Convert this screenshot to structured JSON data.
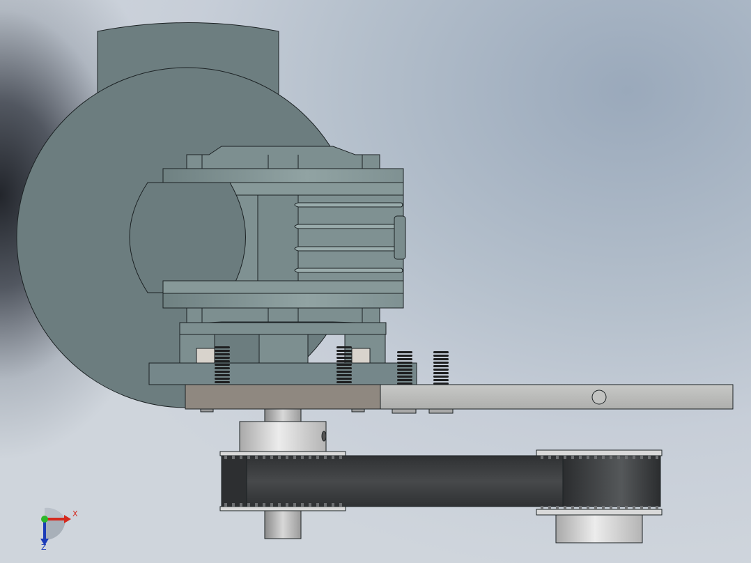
{
  "scene": {
    "type": "cad-assembly-view",
    "colors": {
      "motor_body": "#6e7f82",
      "gearbox": "#849697",
      "plate_dark": "#8f8880",
      "plate_light": "#b7b8b6",
      "belt": "#3d3f41",
      "pulley": "#cfcfcf",
      "screw": "#1e1f20",
      "edge": "#1c2224"
    },
    "components": [
      "motor-housing-icon",
      "gearbox-icon",
      "mounting-plate-icon",
      "timing-belt-icon",
      "drive-pulley-icon",
      "driven-pulley-icon",
      "set-screw-icon"
    ]
  },
  "triad": {
    "x_label": "X",
    "z_label": "Z",
    "x_color": "#d42a1e",
    "y_color": "#2db82a",
    "z_color": "#1b3bb8"
  }
}
